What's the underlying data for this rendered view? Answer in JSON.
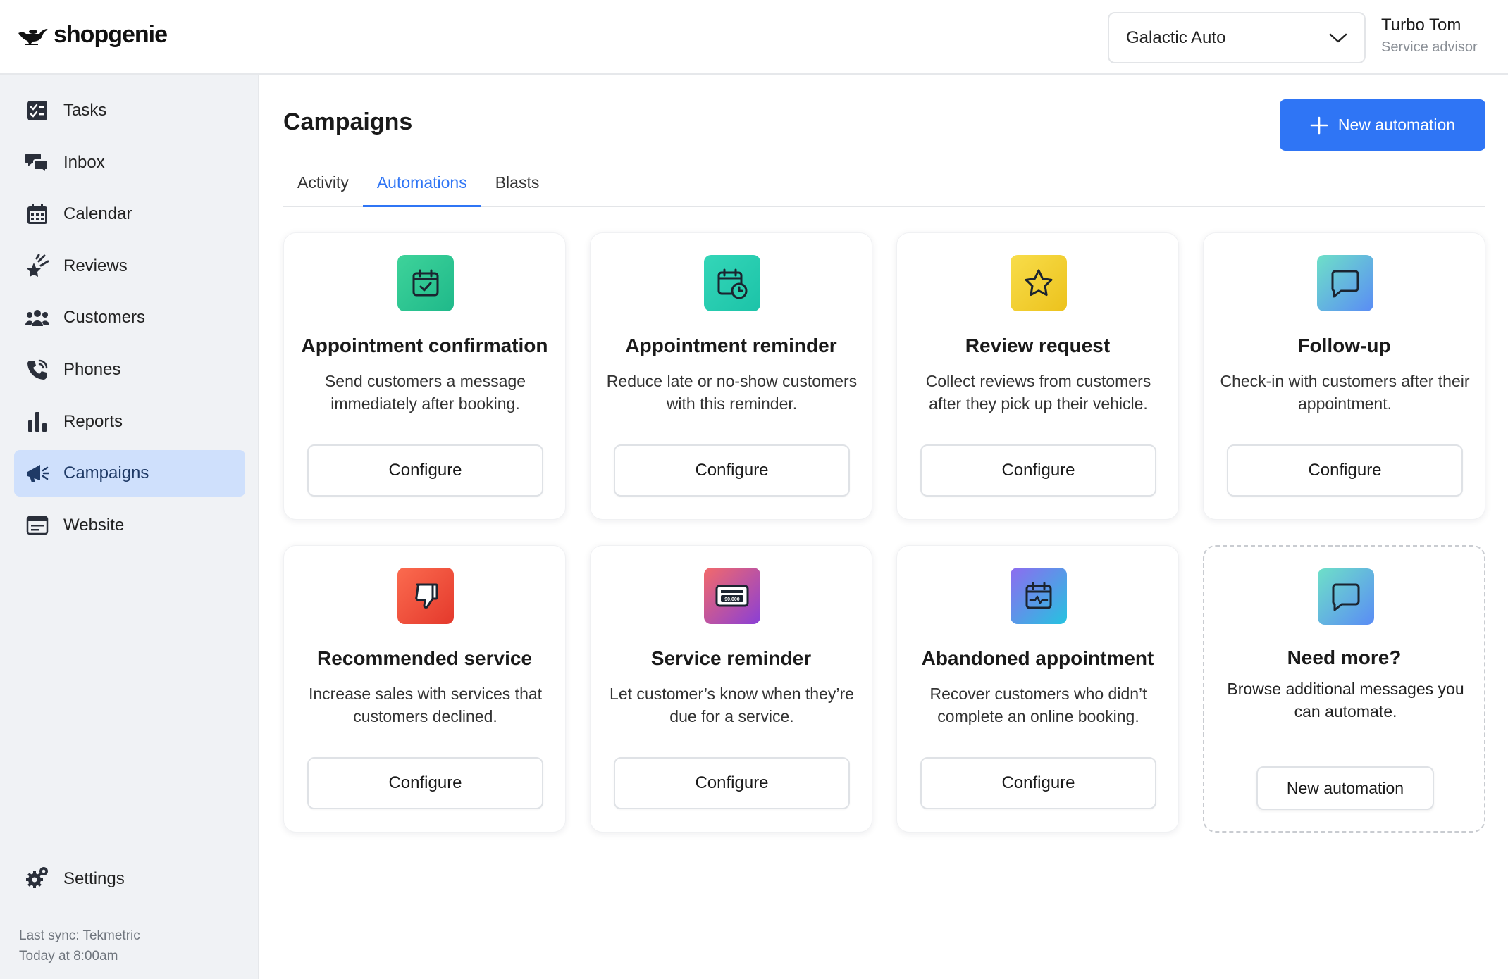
{
  "header": {
    "logo_text": "shopgenie",
    "shop_selector": {
      "value": "Galactic Auto"
    },
    "user": {
      "name": "Turbo Tom",
      "role": "Service advisor"
    }
  },
  "sidebar": {
    "items": [
      {
        "label": "Tasks",
        "icon": "tasks-icon"
      },
      {
        "label": "Inbox",
        "icon": "inbox-icon"
      },
      {
        "label": "Calendar",
        "icon": "calendar-icon"
      },
      {
        "label": "Reviews",
        "icon": "reviews-icon"
      },
      {
        "label": "Customers",
        "icon": "customers-icon"
      },
      {
        "label": "Phones",
        "icon": "phone-icon"
      },
      {
        "label": "Reports",
        "icon": "reports-icon"
      },
      {
        "label": "Campaigns",
        "icon": "megaphone-icon",
        "active": true
      },
      {
        "label": "Website",
        "icon": "website-icon"
      }
    ],
    "settings_label": "Settings",
    "sync": {
      "line1": "Last sync: Tekmetric",
      "line2": "Today at 8:00am"
    }
  },
  "main": {
    "title": "Campaigns",
    "new_automation_label": "New automation",
    "tabs": [
      {
        "label": "Activity"
      },
      {
        "label": "Automations",
        "active": true
      },
      {
        "label": "Blasts"
      }
    ],
    "cards": [
      {
        "title": "Appointment confirmation",
        "desc": "Send customers a message immediately after booking.",
        "button": "Configure",
        "icon": "calendar-check-icon"
      },
      {
        "title": "Appointment reminder",
        "desc": "Reduce late or no-show customers with this reminder.",
        "button": "Configure",
        "icon": "calendar-clock-icon"
      },
      {
        "title": "Review request",
        "desc": "Collect reviews from customers after they pick up their vehicle.",
        "button": "Configure",
        "icon": "star-icon"
      },
      {
        "title": "Follow-up",
        "desc": "Check-in with customers after their appointment.",
        "button": "Configure",
        "icon": "chat-bubble-icon"
      },
      {
        "title": "Recommended service",
        "desc": "Increase sales with services that customers declined.",
        "button": "Configure",
        "icon": "thumbs-down-icon"
      },
      {
        "title": "Service reminder",
        "desc": "Let customer’s know when they’re due for a service.",
        "button": "Configure",
        "icon": "odometer-icon",
        "odometer": "90,000"
      },
      {
        "title": "Abandoned appointment",
        "desc": "Recover customers who didn’t complete an online booking.",
        "button": "Configure",
        "icon": "calendar-pulse-icon"
      }
    ],
    "more": {
      "title": "Need more?",
      "desc": "Browse additional messages you can automate.",
      "button": "New automation"
    }
  },
  "colors": {
    "accent": "#2f75f5",
    "sidebar_bg": "#f0f2f5",
    "active_nav_bg": "#cfe0fc"
  }
}
